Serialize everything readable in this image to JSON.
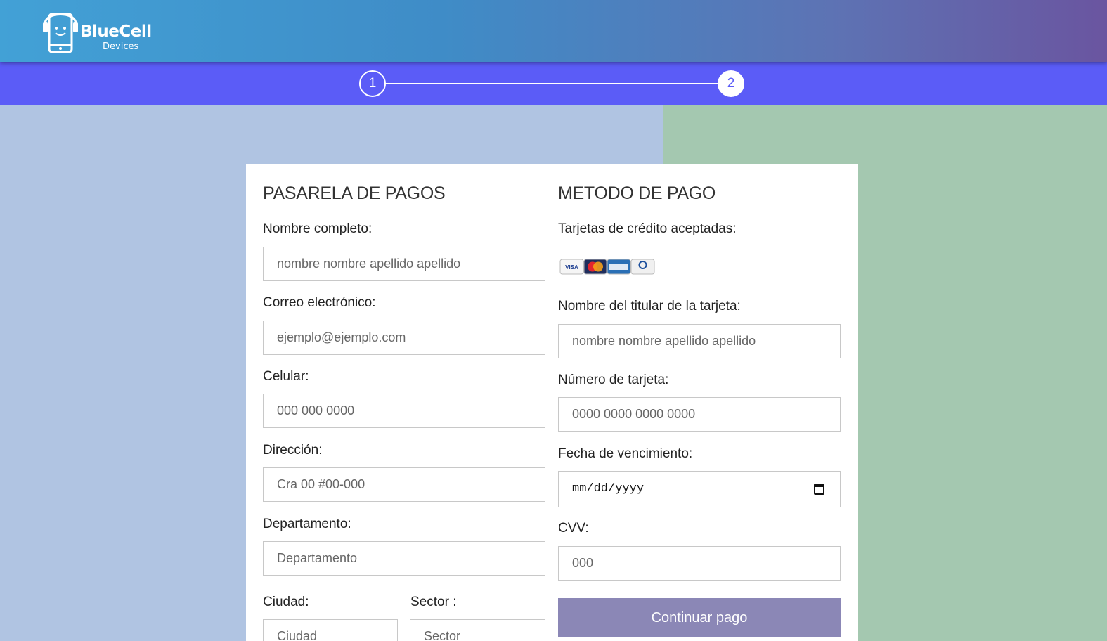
{
  "header": {
    "brand": "BlueCell",
    "brand_sub": "Devices",
    "gradient_start": "#42a1d6",
    "gradient_end": "#6a55a0"
  },
  "stepper": {
    "steps": [
      "1",
      "2"
    ],
    "active_step": "2",
    "bar_color": "#5b5cf7"
  },
  "colors": {
    "left_background": "#b0c4e2",
    "right_background": "#a4c8b0",
    "button": "#8b87b6"
  },
  "form_left": {
    "title": "PASARELA DE PAGOS",
    "full_name": {
      "label": "Nombre completo:",
      "placeholder": "nombre nombre apellido apellido"
    },
    "email": {
      "label": "Correo electrónico:",
      "placeholder": "ejemplo@ejemplo.com"
    },
    "phone": {
      "label": "Celular:",
      "placeholder": "000 000 0000"
    },
    "address": {
      "label": "Dirección:",
      "placeholder": "Cra 00 #00-000"
    },
    "department": {
      "label": "Departamento:",
      "placeholder": "Departamento"
    },
    "city": {
      "label": "Ciudad:",
      "placeholder": "Ciudad"
    },
    "sector": {
      "label": "Sector :",
      "placeholder": "Sector"
    }
  },
  "form_right": {
    "title": "METODO DE PAGO",
    "accepted_cards_label": "Tarjetas de crédito aceptadas:",
    "accepted_cards": [
      "VISA",
      "MasterCard",
      "American Express",
      "Diners Club"
    ],
    "card_holder": {
      "label": "Nombre del titular de la tarjeta:",
      "placeholder": "nombre nombre apellido apellido"
    },
    "card_number": {
      "label": "Número de tarjeta:",
      "placeholder": "0000 0000 0000 0000"
    },
    "expiry": {
      "label": "Fecha de vencimiento:",
      "placeholder": "mm/dd/yyyy"
    },
    "cvv": {
      "label": "CVV:",
      "placeholder": "000"
    },
    "submit_label": "Continuar pago"
  }
}
